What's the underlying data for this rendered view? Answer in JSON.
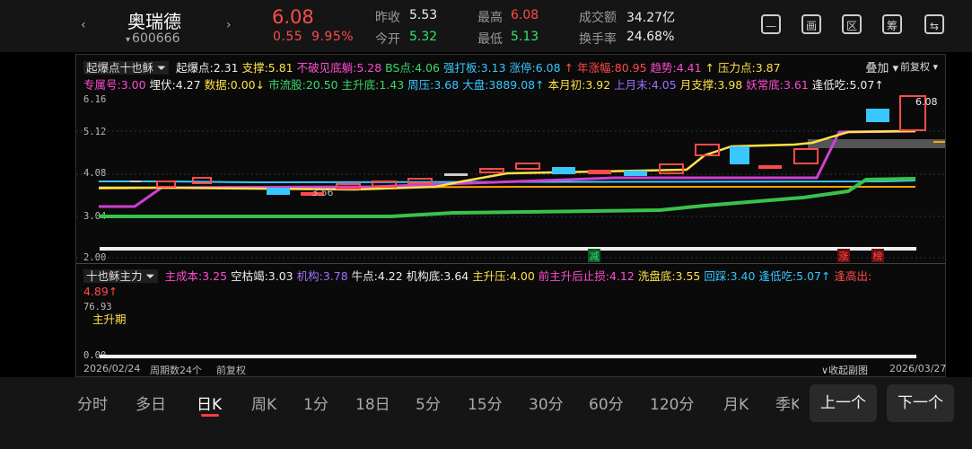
{
  "header": {
    "prev_arrow": "‹",
    "next_arrow": "›",
    "name": "奥瑞德",
    "code": "600666",
    "code_caret": "▾",
    "price": "6.08",
    "change": "0.55",
    "change_pct": "9.95%",
    "stats": {
      "prev_close_label": "昨收",
      "prev_close": "5.53",
      "open_label": "今开",
      "open": "5.32",
      "high_label": "最高",
      "high": "6.08",
      "low_label": "最低",
      "low": "5.13",
      "turnover_label": "成交额",
      "turnover": "34.27亿",
      "turnover_rate_label": "换手率",
      "turnover_rate": "24.68%"
    },
    "tools": [
      "—",
      "画",
      "区",
      "筹",
      "⇆"
    ]
  },
  "main_indicator": {
    "name": "起爆点十也稣",
    "overlay_label": "叠加",
    "adjust_label": "前复权",
    "row1": [
      {
        "label": "起爆点:2.31",
        "color": "#eeeeee"
      },
      {
        "label": "支撑:5.81",
        "color": "#ffe04a"
      },
      {
        "label": "不破见底躺:5.28",
        "color": "#ff4bd2"
      },
      {
        "label": "BS点:4.06",
        "color": "#39d96a"
      },
      {
        "label": "强打板:3.13",
        "color": "#38c8ff"
      },
      {
        "label": "涨停:6.08",
        "color": "#38c8ff"
      },
      {
        "label": "↑ 年涨幅:80.95",
        "color": "#ff4b4b"
      },
      {
        "label": "趋势:4.41",
        "color": "#ff4bd2"
      },
      {
        "label": "↑ 压力点:3.87",
        "color": "#ffe04a"
      }
    ],
    "row2": [
      {
        "label": "专属号:3.00",
        "color": "#ff4bd2"
      },
      {
        "label": "埋伏:4.27",
        "color": "#eeeeee"
      },
      {
        "label": "数据:0.00↓",
        "color": "#ffe04a"
      },
      {
        "label": "市流股:20.50",
        "color": "#39d96a"
      },
      {
        "label": "主升底:1.43",
        "color": "#39d96a"
      },
      {
        "label": "周压:3.68",
        "color": "#38c8ff"
      },
      {
        "label": "大盘:3889.08↑",
        "color": "#38c8ff"
      },
      {
        "label": "本月初:3.92",
        "color": "#ffe04a"
      },
      {
        "label": "上月末:4.05",
        "color": "#a070ff"
      },
      {
        "label": "月支撑:3.98",
        "color": "#ffe04a"
      },
      {
        "label": "妖常底:3.61",
        "color": "#ff4bd2"
      },
      {
        "label": "逢低吃:5.07↑",
        "color": "#eeeeee"
      }
    ],
    "axis": [
      "6.16",
      "5.12",
      "4.08",
      "3.04",
      "2.00"
    ],
    "annotations": {
      "max": "6.08",
      "min": "3.56",
      "tag1": "减",
      "tag2": "涨",
      "tag3": "榜"
    }
  },
  "sub_indicator": {
    "name": "十也稣主力",
    "row1": [
      {
        "label": "主成本:3.25",
        "color": "#ff4bd2"
      },
      {
        "label": "空枯竭:3.03",
        "color": "#eeeeee"
      },
      {
        "label": "机构:3.78",
        "color": "#a070ff"
      },
      {
        "label": "牛点:4.22",
        "color": "#eeeeee"
      },
      {
        "label": "机构底:3.64",
        "color": "#eeeeee"
      },
      {
        "label": "主升压:4.00",
        "color": "#ffe04a"
      },
      {
        "label": "前主升后止损:4.12",
        "color": "#ff4bd2"
      },
      {
        "label": "洗盘底:3.55",
        "color": "#ffe04a"
      },
      {
        "label": "回踩:3.40",
        "color": "#38c8ff"
      },
      {
        "label": "逢低吃:5.07↑",
        "color": "#38c8ff"
      },
      {
        "label": "逢高出:",
        "color": "#ff4b4b"
      }
    ],
    "row2": [
      {
        "label": "4.89↑",
        "color": "#ff4b4b"
      }
    ],
    "axis_top": "76.93",
    "axis_bottom": "0.00",
    "phase_label": "主升期"
  },
  "footer": {
    "start_date": "2026/02/24",
    "period_count": "周期数24个",
    "adjust": "前复权",
    "collapse": "∨收起副图",
    "end_date": "2026/03/27"
  },
  "tabs": [
    "分时",
    "多日",
    "日K",
    "周K",
    "1分",
    "18日",
    "5分",
    "15分",
    "30分",
    "60分",
    "120分",
    "月K",
    "季K"
  ],
  "active_tab": "日K",
  "prev_button": "上一个",
  "next_button": "下一个"
}
